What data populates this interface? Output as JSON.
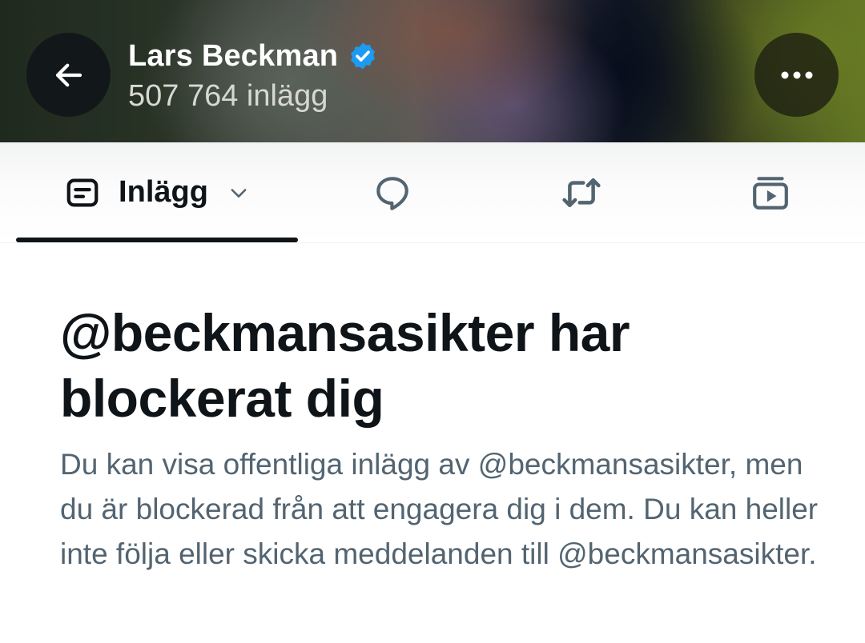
{
  "header": {
    "profile_name": "Lars Beckman",
    "post_count": "507 764 inlägg",
    "back_icon": "arrow-left-icon",
    "more_icon": "more-horizontal-icon",
    "verified_icon": "verified-badge-icon",
    "verified_color": "#1d9bf0"
  },
  "tabs": [
    {
      "label": "Inlägg",
      "icon": "posts-icon",
      "dropdown_icon": "chevron-down-icon",
      "active": true
    },
    {
      "icon": "reply-bubble-icon",
      "active": false
    },
    {
      "icon": "repost-icon",
      "active": false
    },
    {
      "icon": "video-play-icon",
      "active": false
    }
  ],
  "blocked": {
    "title": "@beckmansasikter har blockerat dig",
    "description": "Du kan visa offentliga inlägg av @beckmansasikter, men du är blockerad från att engagera dig i dem. Du kan heller inte följa eller skicka meddelanden till @beckmansasikter."
  },
  "colors": {
    "text_primary": "#0f1419",
    "text_secondary": "#536471",
    "accent": "#1d9bf0"
  }
}
